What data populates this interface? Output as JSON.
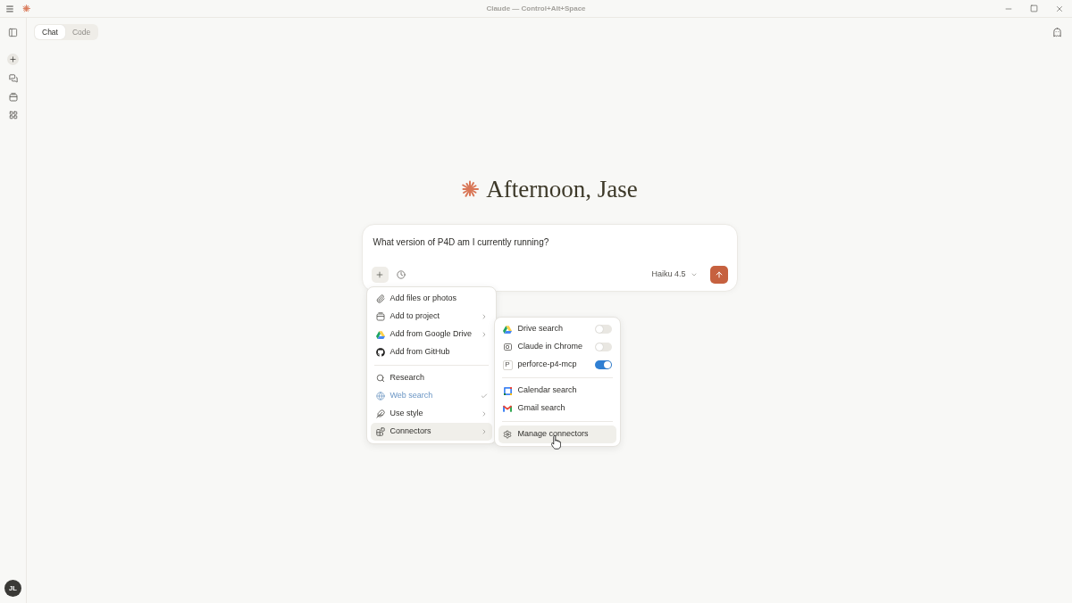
{
  "window": {
    "title": "Claude — Control+Alt+Space"
  },
  "mode_tabs": [
    {
      "label": "Chat",
      "selected": true
    },
    {
      "label": "Code",
      "selected": false
    }
  ],
  "user": {
    "initials": "JL"
  },
  "greeting": "Afternoon, Jase",
  "composer": {
    "value": "What version of P4D am I currently running?",
    "model": "Haiku 4.5"
  },
  "add_menu": {
    "groups": [
      {
        "items": [
          {
            "label": "Add files or photos",
            "submenu": false,
            "checked": false,
            "highlighted": false
          },
          {
            "label": "Add to project",
            "submenu": true,
            "checked": false,
            "highlighted": false
          },
          {
            "label": "Add from Google Drive",
            "submenu": true,
            "checked": false,
            "highlighted": false
          },
          {
            "label": "Add from GitHub",
            "submenu": false,
            "checked": false,
            "highlighted": false
          }
        ]
      },
      {
        "items": [
          {
            "label": "Research",
            "submenu": false,
            "checked": false,
            "highlighted": false
          },
          {
            "label": "Web search",
            "submenu": false,
            "checked": true,
            "highlighted": false
          },
          {
            "label": "Use style",
            "submenu": true,
            "checked": false,
            "highlighted": false
          },
          {
            "label": "Connectors",
            "submenu": true,
            "checked": false,
            "highlighted": true
          }
        ]
      }
    ]
  },
  "connectors_menu": {
    "groups": [
      {
        "items": [
          {
            "kind": "toggle",
            "label": "Drive search",
            "on": false,
            "highlighted": false
          },
          {
            "kind": "toggle",
            "label": "Claude in Chrome",
            "on": false,
            "highlighted": false
          },
          {
            "kind": "toggle",
            "label": "perforce-p4-mcp",
            "on": true,
            "highlighted": false,
            "icon_letter": "P"
          }
        ]
      },
      {
        "items": [
          {
            "kind": "action",
            "label": "Calendar search",
            "highlighted": false
          },
          {
            "kind": "action",
            "label": "Gmail search",
            "highlighted": false
          }
        ]
      },
      {
        "items": [
          {
            "kind": "action",
            "label": "Manage connectors",
            "highlighted": true
          }
        ]
      }
    ]
  }
}
